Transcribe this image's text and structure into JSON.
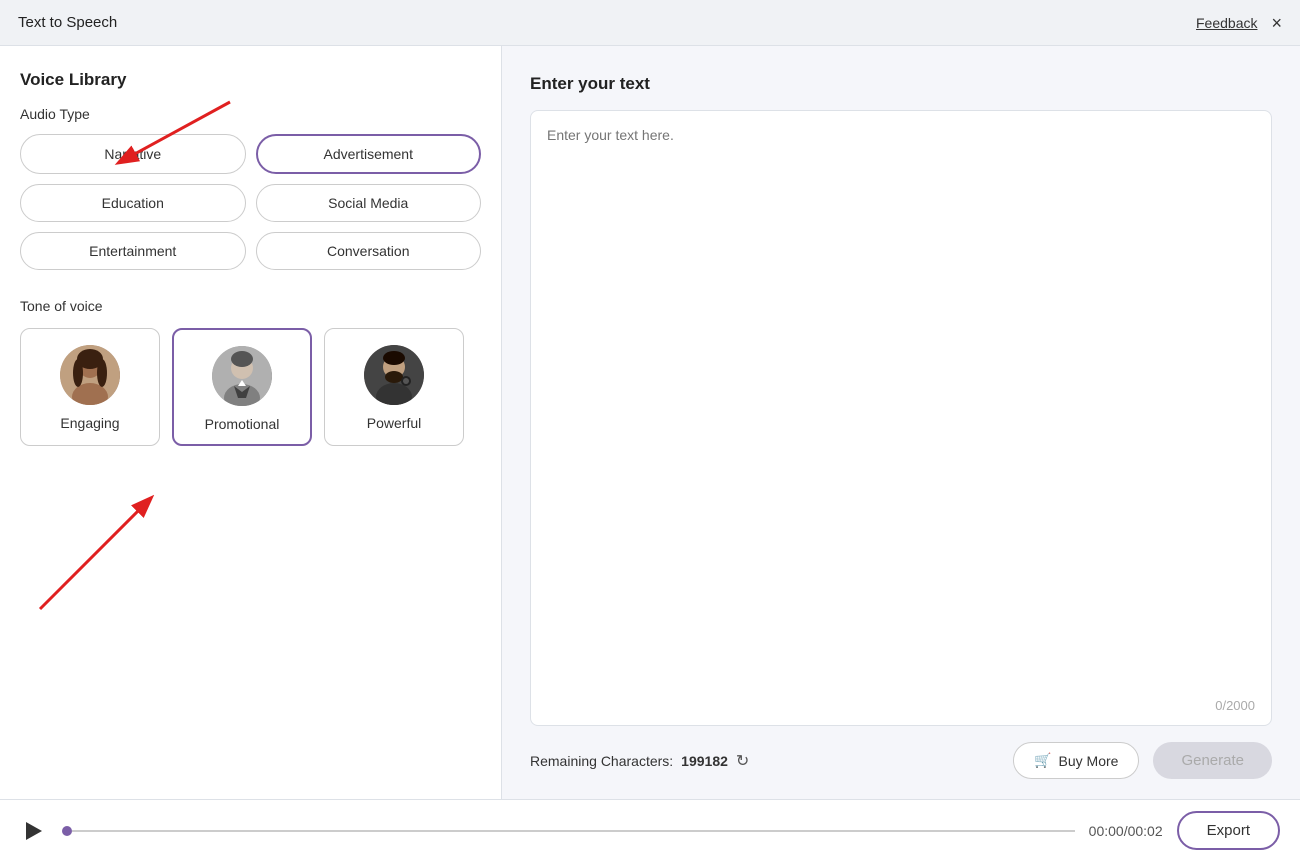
{
  "titleBar": {
    "title": "Text to Speech",
    "feedbackLabel": "Feedback",
    "closeLabel": "×"
  },
  "leftPanel": {
    "voiceLibraryLabel": "Voice Library",
    "audioTypeLabel": "Audio Type",
    "audioTypes": [
      {
        "id": "narrative",
        "label": "Narrative",
        "selected": false
      },
      {
        "id": "advertisement",
        "label": "Advertisement",
        "selected": true
      },
      {
        "id": "education",
        "label": "Education",
        "selected": false
      },
      {
        "id": "social-media",
        "label": "Social Media",
        "selected": false
      },
      {
        "id": "entertainment",
        "label": "Entertainment",
        "selected": false
      },
      {
        "id": "conversation",
        "label": "Conversation",
        "selected": false
      }
    ],
    "toneLabel": "Tone of voice",
    "tones": [
      {
        "id": "engaging",
        "label": "Engaging",
        "selected": false,
        "avatar": "engaging"
      },
      {
        "id": "promotional",
        "label": "Promotional",
        "selected": true,
        "avatar": "promotional"
      },
      {
        "id": "powerful",
        "label": "Powerful",
        "selected": false,
        "avatar": "powerful"
      }
    ]
  },
  "rightPanel": {
    "enterTextTitle": "Enter your text",
    "textPlaceholder": "Enter your text here.",
    "textValue": "",
    "charCount": "0/2000",
    "remainingLabel": "Remaining Characters:",
    "remainingCount": "199182",
    "buyMoreLabel": "Buy More",
    "generateLabel": "Generate"
  },
  "playerBar": {
    "timeDisplay": "00:00/00:02",
    "exportLabel": "Export"
  }
}
